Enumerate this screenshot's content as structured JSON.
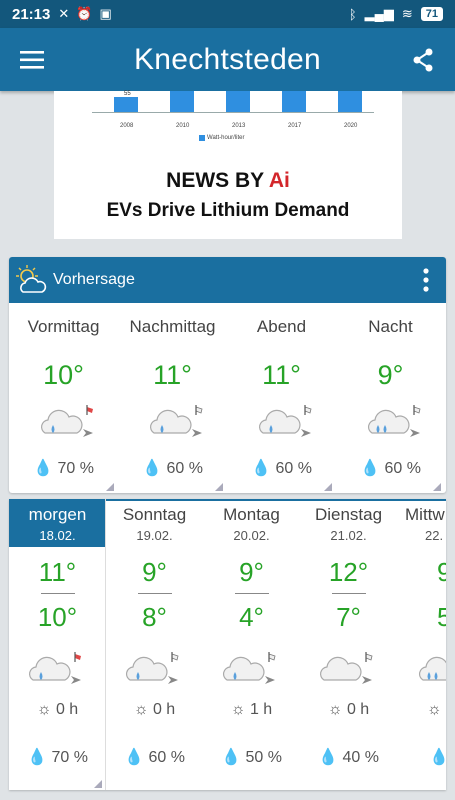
{
  "status": {
    "time": "21:13",
    "battery": "71"
  },
  "appbar": {
    "title": "Knechtsteden"
  },
  "ad": {
    "bar_label": "55",
    "years": [
      "2008",
      "2010",
      "2013",
      "2017",
      "2020"
    ],
    "legend": "Watt-hour/liter",
    "headline_prefix": "NEWS BY ",
    "headline_ai": "Ai",
    "subtitle": "EVs Drive Lithium Demand"
  },
  "forecast": {
    "title": "Vorhersage",
    "periods": [
      {
        "name": "Vormittag",
        "temp": "10°",
        "rain": "70 %"
      },
      {
        "name": "Nachmittag",
        "temp": "11°",
        "rain": "60 %"
      },
      {
        "name": "Abend",
        "temp": "11°",
        "rain": "60 %"
      },
      {
        "name": "Nacht",
        "temp": "9°",
        "rain": "60 %"
      }
    ]
  },
  "daily": [
    {
      "name": "morgen",
      "date": "18.02.",
      "max": "11°",
      "min": "10°",
      "sun": "0 h",
      "rain": "70 %"
    },
    {
      "name": "Sonntag",
      "date": "19.02.",
      "max": "9°",
      "min": "8°",
      "sun": "0 h",
      "rain": "60 %"
    },
    {
      "name": "Montag",
      "date": "20.02.",
      "max": "9°",
      "min": "4°",
      "sun": "1 h",
      "rain": "50 %"
    },
    {
      "name": "Dienstag",
      "date": "21.02.",
      "max": "12°",
      "min": "7°",
      "sun": "0 h",
      "rain": "40 %"
    },
    {
      "name": "Mittw",
      "date": "22.",
      "max": "9",
      "min": "5",
      "sun": "",
      "rain": ""
    }
  ],
  "colors": {
    "primary": "#1a6fa0",
    "temp_green": "#27a327"
  }
}
